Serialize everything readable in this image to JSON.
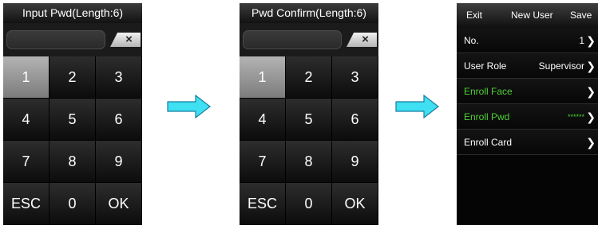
{
  "screen1": {
    "title": "Input Pwd(Length:6)",
    "clear_label": "×",
    "keys": [
      "1",
      "2",
      "3",
      "4",
      "5",
      "6",
      "7",
      "8",
      "9",
      "ESC",
      "0",
      "OK"
    ]
  },
  "screen2": {
    "title": "Pwd Confirm(Length:6)",
    "clear_label": "×",
    "keys": [
      "1",
      "2",
      "3",
      "4",
      "5",
      "6",
      "7",
      "8",
      "9",
      "ESC",
      "0",
      "OK"
    ]
  },
  "screen3": {
    "header": {
      "exit": "Exit",
      "title": "New User",
      "save": "Save"
    },
    "rows": [
      {
        "label": "No.",
        "value": "1"
      },
      {
        "label": "User Role",
        "value": "Supervisor"
      },
      {
        "label": "Enroll Face",
        "value": ""
      },
      {
        "label": "Enroll Pwd",
        "value": "******"
      },
      {
        "label": "Enroll Card",
        "value": ""
      }
    ],
    "chevron": "❯"
  },
  "colors": {
    "arrow": "#3ee0f2",
    "highlight_text": "#4fcf36",
    "active_key": "#9a9a9a"
  }
}
